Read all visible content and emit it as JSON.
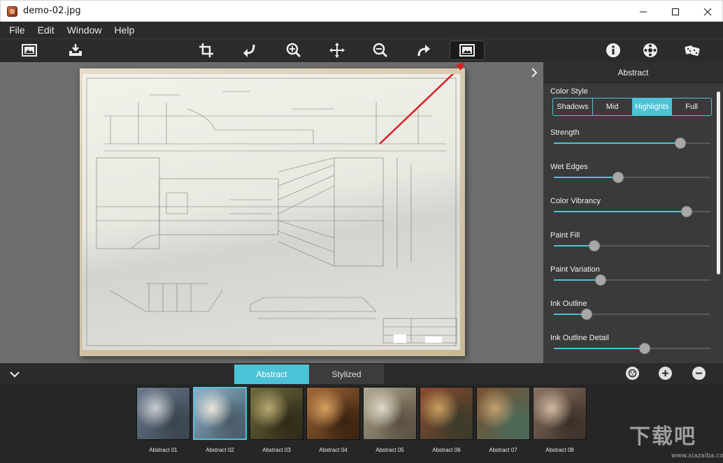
{
  "window": {
    "title": "demo-02.jpg",
    "minimize_icon": "minimize-icon",
    "maximize_icon": "maximize-icon",
    "close_icon": "close-icon"
  },
  "menu": [
    "File",
    "Edit",
    "Window",
    "Help"
  ],
  "toolbar": {
    "left": [
      "open-image-icon",
      "save-icon"
    ],
    "center": [
      "crop-icon",
      "undo-icon",
      "zoom-in-icon",
      "move-icon",
      "zoom-out-icon",
      "redo-icon",
      "fit-screen-icon"
    ],
    "right": [
      "info-icon",
      "settings-icon",
      "random-style-icon"
    ],
    "active": "fit-screen-icon"
  },
  "panel": {
    "title": "Abstract",
    "color_style": {
      "label": "Color Style",
      "options": [
        "Shadows",
        "Mid",
        "Highlights",
        "Full"
      ],
      "selected": "Highlights"
    },
    "sliders": [
      {
        "label": "Strength",
        "value": 0.81
      },
      {
        "label": "Wet Edges",
        "value": 0.41
      },
      {
        "label": "Color Vibrancy",
        "value": 0.85
      },
      {
        "label": "Paint Fill",
        "value": 0.26
      },
      {
        "label": "Paint Variation",
        "value": 0.3
      },
      {
        "label": "Ink Outline",
        "value": 0.21
      },
      {
        "label": "Ink Outline Detail",
        "value": 0.58
      }
    ]
  },
  "tabs": {
    "abstract": "Abstract",
    "stylized": "Stylized",
    "selected": "Abstract"
  },
  "thumbnails": [
    {
      "label": "Abstract 01",
      "colors": [
        "#6b7a8c",
        "#c8ccd0",
        "#3a4450"
      ]
    },
    {
      "label": "Abstract 02",
      "colors": [
        "#8ab2cc",
        "#e8e4d8",
        "#4a5a66"
      ]
    },
    {
      "label": "Abstract 03",
      "colors": [
        "#6e6a3c",
        "#b8a872",
        "#2e2a18"
      ]
    },
    {
      "label": "Abstract 04",
      "colors": [
        "#a06838",
        "#d8a060",
        "#3a2210"
      ]
    },
    {
      "label": "Abstract 05",
      "colors": [
        "#b0a890",
        "#e0d8c8",
        "#5a5040"
      ]
    },
    {
      "label": "Abstract 06",
      "colors": [
        "#8a4a30",
        "#c8a060",
        "#3a3a2a"
      ]
    },
    {
      "label": "Abstract 07",
      "colors": [
        "#7a5030",
        "#c0a070",
        "#4a6a5a"
      ]
    },
    {
      "label": "Abstract 08",
      "colors": [
        "#8a7060",
        "#d0b8a0",
        "#3a3028"
      ]
    }
  ],
  "selected_thumbnail": "Abstract 02",
  "bottom_buttons": [
    "preset-icon",
    "add-icon",
    "remove-icon"
  ],
  "accent_color": "#4cc3d6",
  "watermark": {
    "text": "下载吧",
    "sub": "www.xiazaiba.com"
  }
}
